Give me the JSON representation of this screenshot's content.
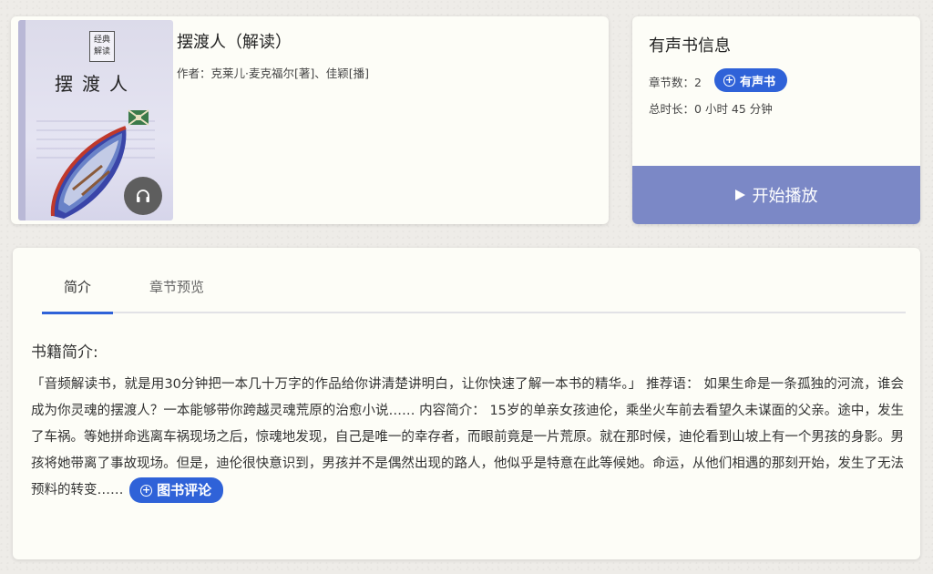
{
  "book": {
    "title": "摆渡人（解读）",
    "author_label": "作者：",
    "author": "克莱儿·麦克福尔[著]、佳颖[播]",
    "cover": {
      "seal_line1": "经典",
      "seal_line2": "解读",
      "title": "摆渡人"
    }
  },
  "audio_info": {
    "heading": "有声书信息",
    "chapters_label": "章节数：",
    "chapters_value": "2",
    "duration_label": "总时长：",
    "duration_value": "0 小时 45 分钟",
    "audio_badge": "有声书",
    "play_label": "开始播放"
  },
  "tabs": [
    {
      "label": "简介",
      "active": true
    },
    {
      "label": "章节预览",
      "active": false
    }
  ],
  "intro": {
    "heading": "书籍简介:",
    "text": "「音频解读书，就是用30分钟把一本几十万字的作品给你讲清楚讲明白，让你快速了解一本书的精华。」 推荐语： 如果生命是一条孤独的河流，谁会成为你灵魂的摆渡人？一本能够带你跨越灵魂荒原的治愈小说…… 内容简介： 15岁的单亲女孩迪伦，乘坐火车前去看望久未谋面的父亲。途中，发生了车祸。等她拼命逃离车祸现场之后，惊魂地发现，自己是唯一的幸存者，而眼前竟是一片荒原。就在那时候，迪伦看到山坡上有一个男孩的身影。男孩将她带离了事故现场。但是，迪伦很快意识到，男孩并不是偶然出现的路人，他似乎是特意在此等候她。命运，从他们相遇的那刻开始，发生了无法预料的转变……",
    "review_button": "图书评论"
  },
  "colors": {
    "accent": "#2f62d8",
    "play_button": "#7b88c6",
    "card_bg": "#fdfdf7"
  }
}
